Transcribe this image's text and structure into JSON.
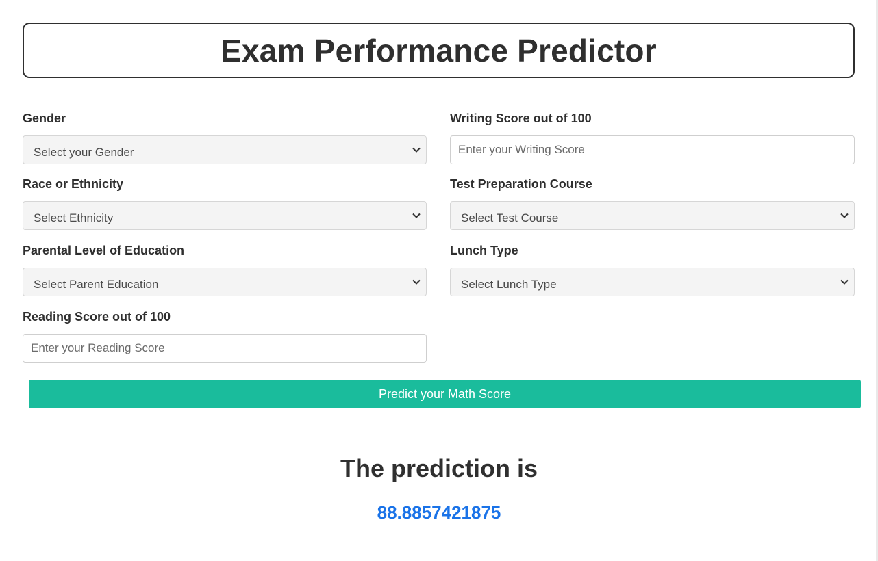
{
  "header": {
    "title": "Exam Performance Predictor"
  },
  "form": {
    "gender": {
      "label": "Gender",
      "placeholder": "Select your Gender"
    },
    "ethnicity": {
      "label": "Race or Ethnicity",
      "placeholder": "Select Ethnicity"
    },
    "parent_education": {
      "label": "Parental Level of Education",
      "placeholder": "Select Parent Education"
    },
    "reading_score": {
      "label": "Reading Score out of 100",
      "placeholder": "Enter your Reading Score",
      "value": ""
    },
    "writing_score": {
      "label": "Writing Score out of 100",
      "placeholder": "Enter your Writing Score",
      "value": ""
    },
    "test_prep": {
      "label": "Test Preparation Course",
      "placeholder": "Select Test Course"
    },
    "lunch": {
      "label": "Lunch Type",
      "placeholder": "Select Lunch Type"
    },
    "submit_label": "Predict your Math Score"
  },
  "result": {
    "heading": "The prediction is",
    "value": "88.8857421875"
  },
  "colors": {
    "button": "#1abc9c",
    "result_value": "#1a73e8",
    "text": "#2f2f2f"
  },
  "icons": {
    "select_chevron": "chevron-down-icon"
  }
}
